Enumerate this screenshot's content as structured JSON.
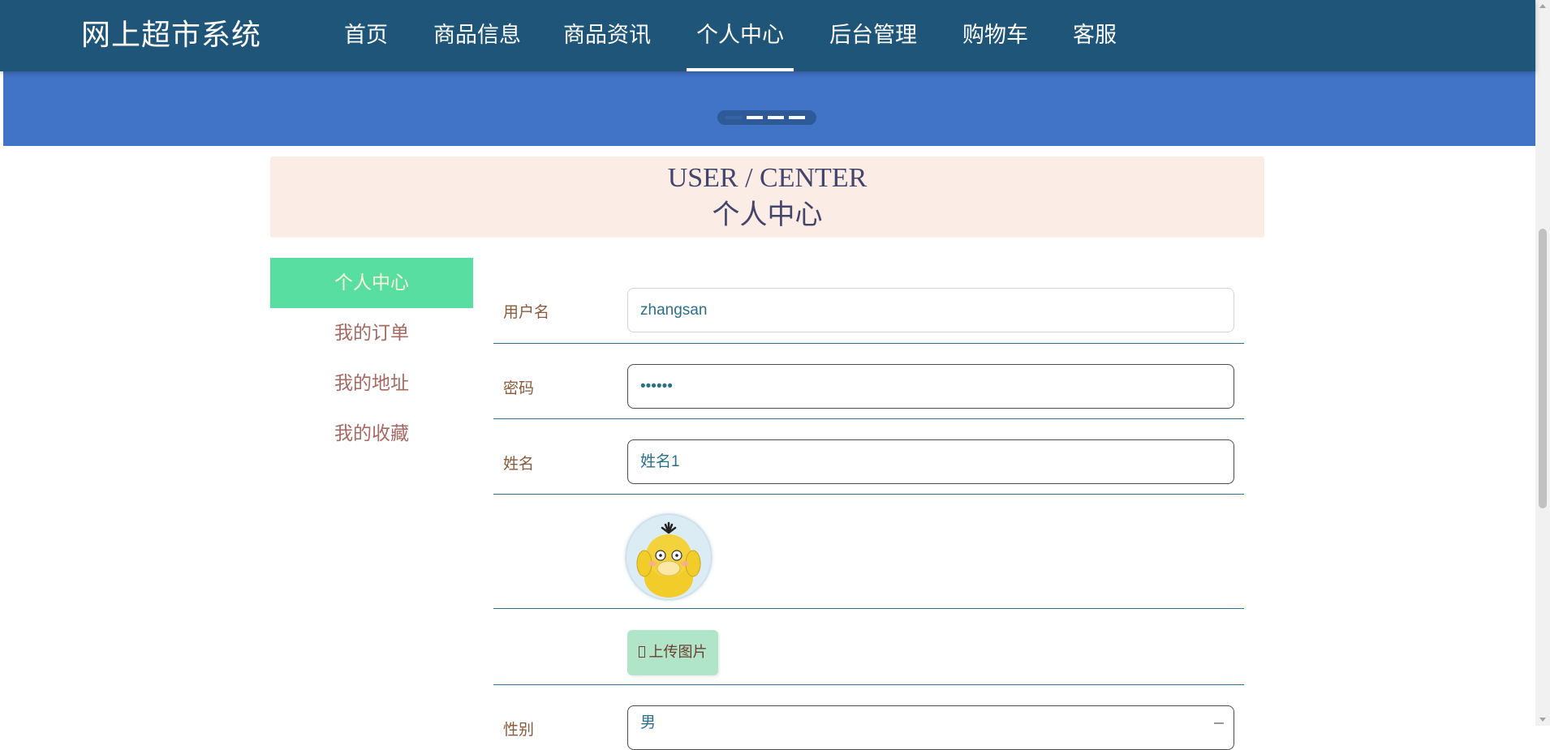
{
  "header": {
    "brand": "网上超市系统",
    "nav": [
      {
        "label": "首页"
      },
      {
        "label": "商品信息"
      },
      {
        "label": "商品资讯"
      },
      {
        "label": "个人中心",
        "active": true
      },
      {
        "label": "后台管理"
      },
      {
        "label": "购物车"
      },
      {
        "label": "客服"
      }
    ]
  },
  "banner": {
    "slide_count": 4,
    "active_slide": 1
  },
  "section": {
    "title_en": "USER / CENTER",
    "title_cn": "个人中心"
  },
  "sidebar": {
    "items": [
      {
        "label": "个人中心",
        "active": true
      },
      {
        "label": "我的订单"
      },
      {
        "label": "我的地址"
      },
      {
        "label": "我的收藏"
      }
    ]
  },
  "form": {
    "username_label": "用户名",
    "username_value": "zhangsan",
    "password_label": "密码",
    "password_value": "••••••",
    "name_label": "姓名",
    "name_value": "姓名1",
    "upload_label": "上传图片",
    "gender_label": "性别",
    "gender_value": "男"
  },
  "colors": {
    "nav_bg": "#1e5579",
    "banner_bg": "#4173c6",
    "section_bg": "#fbede6",
    "sidebar_active_bg": "#59dea2",
    "upload_bg": "#b0e5c9"
  },
  "icons": {
    "avatar": "yellow-duck-avatar",
    "upload": "upload-icon"
  }
}
